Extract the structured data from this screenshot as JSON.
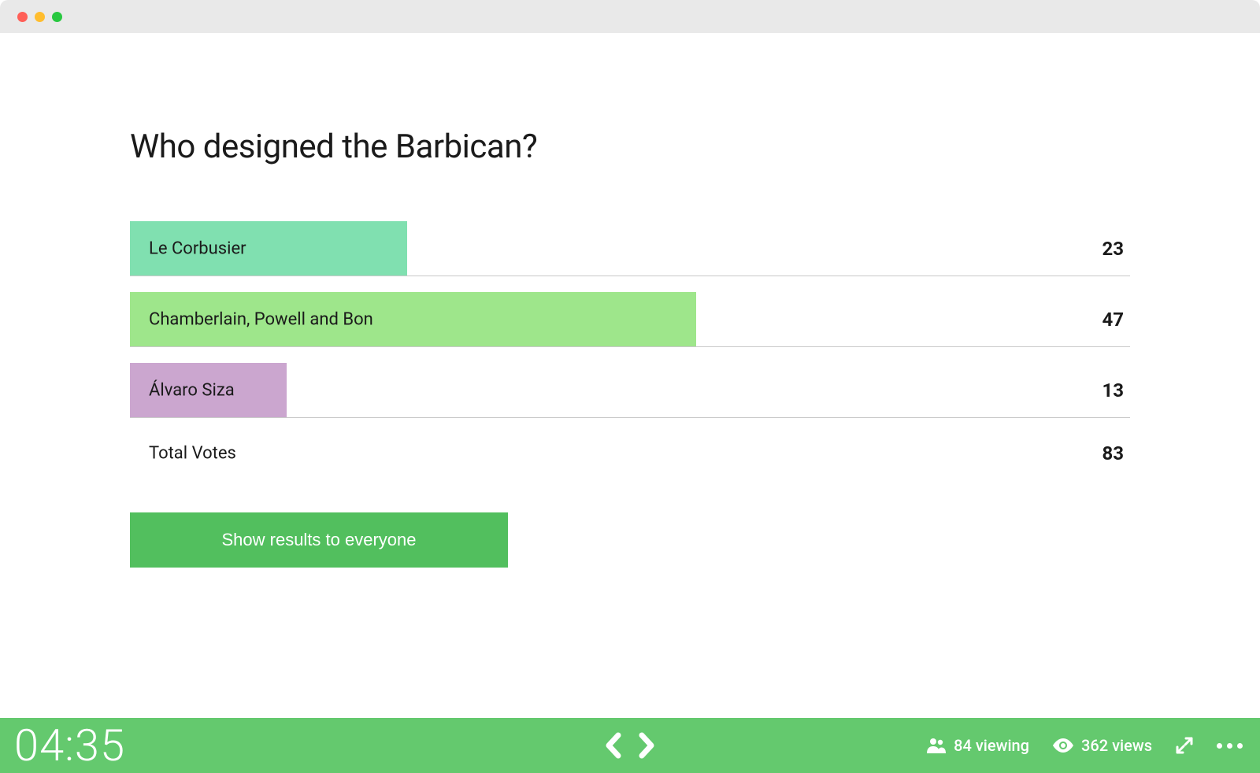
{
  "poll": {
    "question": "Who designed the Barbican?",
    "options": [
      {
        "label": "Le Corbusier",
        "votes": 23,
        "color": "#80e0b0"
      },
      {
        "label": "Chamberlain, Powell and Bon",
        "votes": 47,
        "color": "#9ee68b"
      },
      {
        "label": "Álvaro Siza",
        "votes": 13,
        "color": "#cba6cf"
      }
    ],
    "total_label": "Total Votes",
    "total_votes": 83,
    "button_label": "Show results to everyone"
  },
  "toolbar": {
    "timer": "04:35",
    "viewing_count": 84,
    "viewing_suffix": "viewing",
    "views_count": 362,
    "views_suffix": "views"
  },
  "colors": {
    "accent": "#64c96e",
    "button": "#52bf5e"
  },
  "chart_data": {
    "type": "bar",
    "orientation": "horizontal",
    "title": "Who designed the Barbican?",
    "categories": [
      "Le Corbusier",
      "Chamberlain, Powell and Bon",
      "Álvaro Siza"
    ],
    "values": [
      23,
      47,
      13
    ],
    "total": 83,
    "xlabel": "",
    "ylabel": "",
    "colors": [
      "#80e0b0",
      "#9ee68b",
      "#cba6cf"
    ]
  }
}
